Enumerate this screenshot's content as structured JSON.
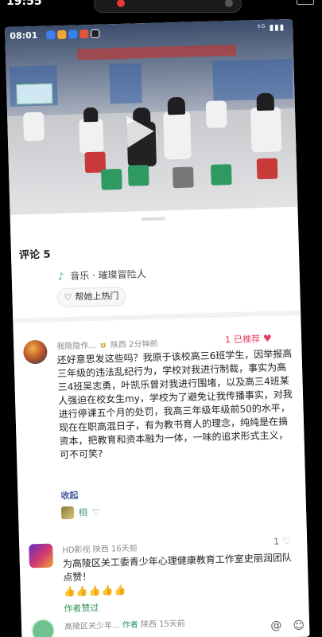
{
  "status_bar": {
    "time": "19:55"
  },
  "video": {
    "inner_time": "08:01",
    "inner_status_right": "⁵ᴳ ▮▮▮",
    "banner_text": ""
  },
  "comments_sheet": {
    "title": "评论 5",
    "music_label": "音乐 · 璀璨冒险人",
    "help_button": "帮她上热门"
  },
  "comments": [
    {
      "user": "我隐隐作...",
      "location": "陕西",
      "time": "2分钟前",
      "like_count": "1",
      "liked_label": "已推荐",
      "text": "还好意思发这些吗？我原于该校高三6班学生，因举报高三年级的违法乱纪行为，学校对我进行制裁，事实为高三4班吴志勇，叶凯乐曾对我进行围堵，以及高三4班某人强迫在校女生my，学校为了避免让我传播事实，对我进行停课五个月的处罚，我高三年级年级前50的水平，现在在职高混日子，有为教书育人的理念，纯纯是在搞资本，把教育和资本融为一体，一味的追求形式主义，可不可笑?",
      "fold_label": "收起",
      "reply_user": "栩"
    },
    {
      "user": "HD影视",
      "location": "陕西",
      "time": "16天前",
      "like_count": "1",
      "text": "为高陵区关工委青少年心理健康教育工作室史丽润团队点赞！",
      "emojis": "👍👍👍👍👍",
      "author_liked": "作者赞过"
    },
    {
      "user": "高陵区关少年...",
      "author_tag": "作者",
      "location": "陕西",
      "time": "15天前"
    }
  ],
  "icons": [
    "play-icon",
    "music-note-icon",
    "fire-icon",
    "heart-icon",
    "gold-badge-icon"
  ]
}
